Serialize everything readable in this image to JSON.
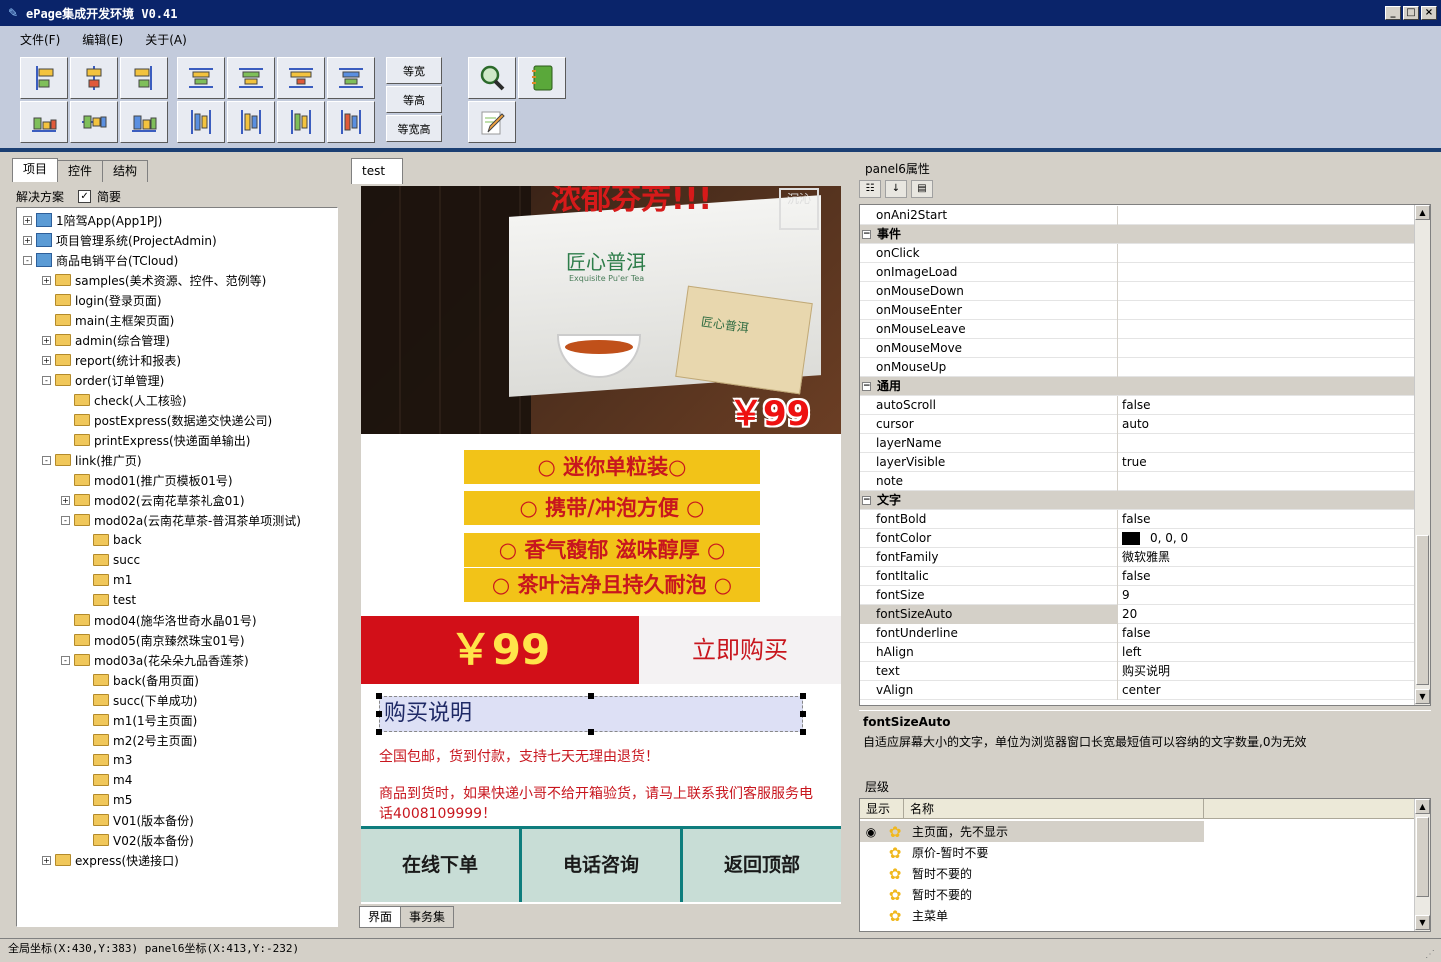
{
  "window": {
    "title": "ePage集成开发环境 V0.41"
  },
  "menu": [
    "文件(F)",
    "编辑(E)",
    "关于(A)"
  ],
  "toolbar": {
    "align_buttons": [
      "align-left",
      "align-center-horizontal",
      "align-right",
      "align-top",
      "align-middle-vertical",
      "align-bottom"
    ],
    "space_buttons": [
      "distribute-1",
      "distribute-2",
      "distribute-3",
      "distribute-4",
      "distribute-5",
      "distribute-6",
      "distribute-7",
      "distribute-8"
    ],
    "size_labels": [
      "等宽",
      "等高",
      "等宽高"
    ]
  },
  "left": {
    "tabs": [
      "项目",
      "控件",
      "结构"
    ],
    "solution_label": "解决方案",
    "simple_label": "简要",
    "tree": [
      {
        "label": "1陪驾App(App1PJ)",
        "level": 0,
        "exp": "+",
        "icon": "proj"
      },
      {
        "label": "项目管理系统(ProjectAdmin)",
        "level": 0,
        "exp": "+",
        "icon": "proj"
      },
      {
        "label": "商品电销平台(TCloud)",
        "level": 0,
        "exp": "-",
        "icon": "proj"
      },
      {
        "label": "samples(美术资源、控件、范例等)",
        "level": 1,
        "exp": "+",
        "icon": "folder"
      },
      {
        "label": "login(登录页面)",
        "level": 1,
        "exp": "",
        "icon": "folder"
      },
      {
        "label": "main(主框架页面)",
        "level": 1,
        "exp": "",
        "icon": "folder"
      },
      {
        "label": "admin(综合管理)",
        "level": 1,
        "exp": "+",
        "icon": "folder"
      },
      {
        "label": "report(统计和报表)",
        "level": 1,
        "exp": "+",
        "icon": "folder"
      },
      {
        "label": "order(订单管理)",
        "level": 1,
        "exp": "-",
        "icon": "folder"
      },
      {
        "label": "check(人工核验)",
        "level": 2,
        "exp": "",
        "icon": "folder"
      },
      {
        "label": "postExpress(数据递交快递公司)",
        "level": 2,
        "exp": "",
        "icon": "folder"
      },
      {
        "label": "printExpress(快递面单输出)",
        "level": 2,
        "exp": "",
        "icon": "folder"
      },
      {
        "label": "link(推广页)",
        "level": 1,
        "exp": "-",
        "icon": "folder"
      },
      {
        "label": "mod01(推广页模板01号)",
        "level": 2,
        "exp": "",
        "icon": "folder"
      },
      {
        "label": "mod02(云南花草茶礼盒01)",
        "level": 2,
        "exp": "+",
        "icon": "folder"
      },
      {
        "label": "mod02a(云南花草茶-普洱茶单项测试)",
        "level": 2,
        "exp": "-",
        "icon": "folder"
      },
      {
        "label": "back",
        "level": 3,
        "exp": "",
        "icon": "folder"
      },
      {
        "label": "succ",
        "level": 3,
        "exp": "",
        "icon": "folder"
      },
      {
        "label": "m1",
        "level": 3,
        "exp": "",
        "icon": "folder"
      },
      {
        "label": "test",
        "level": 3,
        "exp": "",
        "icon": "folder"
      },
      {
        "label": "mod04(施华洛世奇水晶01号)",
        "level": 2,
        "exp": "",
        "icon": "folder"
      },
      {
        "label": "mod05(南京臻然珠宝01号)",
        "level": 2,
        "exp": "",
        "icon": "folder"
      },
      {
        "label": "mod03a(花朵朵九品香莲茶)",
        "level": 2,
        "exp": "-",
        "icon": "folder"
      },
      {
        "label": "back(备用页面)",
        "level": 3,
        "exp": "",
        "icon": "folder"
      },
      {
        "label": "succ(下单成功)",
        "level": 3,
        "exp": "",
        "icon": "folder"
      },
      {
        "label": "m1(1号主页面)",
        "level": 3,
        "exp": "",
        "icon": "folder"
      },
      {
        "label": "m2(2号主页面)",
        "level": 3,
        "exp": "",
        "icon": "folder"
      },
      {
        "label": "m3",
        "level": 3,
        "exp": "",
        "icon": "folder"
      },
      {
        "label": "m4",
        "level": 3,
        "exp": "",
        "icon": "folder"
      },
      {
        "label": "m5",
        "level": 3,
        "exp": "",
        "icon": "folder"
      },
      {
        "label": "V01(版本备份)",
        "level": 3,
        "exp": "",
        "icon": "folder"
      },
      {
        "label": "V02(版本备份)",
        "level": 3,
        "exp": "",
        "icon": "folder"
      },
      {
        "label": "express(快递接口)",
        "level": 1,
        "exp": "+",
        "icon": "folder"
      }
    ]
  },
  "center": {
    "tab": "test",
    "bottom_tabs": [
      "界面",
      "事务集"
    ],
    "hero": {
      "top_text": "浓郁芬芳!!!",
      "box_label": "匠心普洱",
      "box_sub": "Exquisite Pu'er Tea",
      "pack_label": "匠心普洱",
      "badge": "沉沁",
      "price": "￥99"
    },
    "features": [
      "○ 迷你单粒装○",
      "○ 携带/冲泡方便 ○",
      "○ 香气馥郁 滋味醇厚 ○",
      "○ 茶叶洁净且持久耐泡 ○"
    ],
    "price_block": "￥99",
    "buy_label": "立即购买",
    "selected_label": "购买说明",
    "note1": "全国包邮，货到付款，支持七天无理由退货！",
    "note2": "商品到货时，如果快递小哥不给开箱验货，请马上联系我们客服服务电话4008109999！",
    "footer": [
      "在线下单",
      "电话咨询",
      "返回顶部"
    ]
  },
  "right": {
    "title": "panel6属性",
    "props": [
      {
        "type": "row",
        "name": "onAni2Start",
        "value": ""
      },
      {
        "type": "cat",
        "name": "事件"
      },
      {
        "type": "row",
        "name": "onClick",
        "value": ""
      },
      {
        "type": "row",
        "name": "onImageLoad",
        "value": ""
      },
      {
        "type": "row",
        "name": "onMouseDown",
        "value": ""
      },
      {
        "type": "row",
        "name": "onMouseEnter",
        "value": ""
      },
      {
        "type": "row",
        "name": "onMouseLeave",
        "value": ""
      },
      {
        "type": "row",
        "name": "onMouseMove",
        "value": ""
      },
      {
        "type": "row",
        "name": "onMouseUp",
        "value": ""
      },
      {
        "type": "cat",
        "name": "通用"
      },
      {
        "type": "row",
        "name": "autoScroll",
        "value": "false"
      },
      {
        "type": "row",
        "name": "cursor",
        "value": "auto"
      },
      {
        "type": "row",
        "name": "layerName",
        "value": ""
      },
      {
        "type": "row",
        "name": "layerVisible",
        "value": "true"
      },
      {
        "type": "row",
        "name": "note",
        "value": ""
      },
      {
        "type": "cat",
        "name": "文字"
      },
      {
        "type": "row",
        "name": "fontBold",
        "value": "false"
      },
      {
        "type": "row",
        "name": "fontColor",
        "value": "0, 0, 0",
        "swatch": "#000000"
      },
      {
        "type": "row",
        "name": "fontFamily",
        "value": "微软雅黑"
      },
      {
        "type": "row",
        "name": "fontItalic",
        "value": "false"
      },
      {
        "type": "row",
        "name": "fontSize",
        "value": "9"
      },
      {
        "type": "row",
        "name": "fontSizeAuto",
        "value": "20",
        "selected": true
      },
      {
        "type": "row",
        "name": "fontUnderline",
        "value": "false"
      },
      {
        "type": "row",
        "name": "hAlign",
        "value": "left"
      },
      {
        "type": "row",
        "name": "text",
        "value": "购买说明"
      },
      {
        "type": "row",
        "name": "vAlign",
        "value": "center"
      }
    ],
    "desc_title": "fontSizeAuto",
    "desc_text": "自适应屏幕大小的文字，单位为浏览器窗口长宽最短值可以容纳的文字数量,0为无效",
    "layer_title": "层级",
    "layer_headers": [
      "显示",
      "名称"
    ],
    "layers": [
      {
        "name": "主页面，先不显示",
        "selected": true
      },
      {
        "name": "原价-暂时不要"
      },
      {
        "name": "暂时不要的"
      },
      {
        "name": "暂时不要的"
      },
      {
        "name": "主菜单"
      }
    ]
  },
  "status": "全局坐标(X:430,Y:383)  panel6坐标(X:413,Y:-232)"
}
